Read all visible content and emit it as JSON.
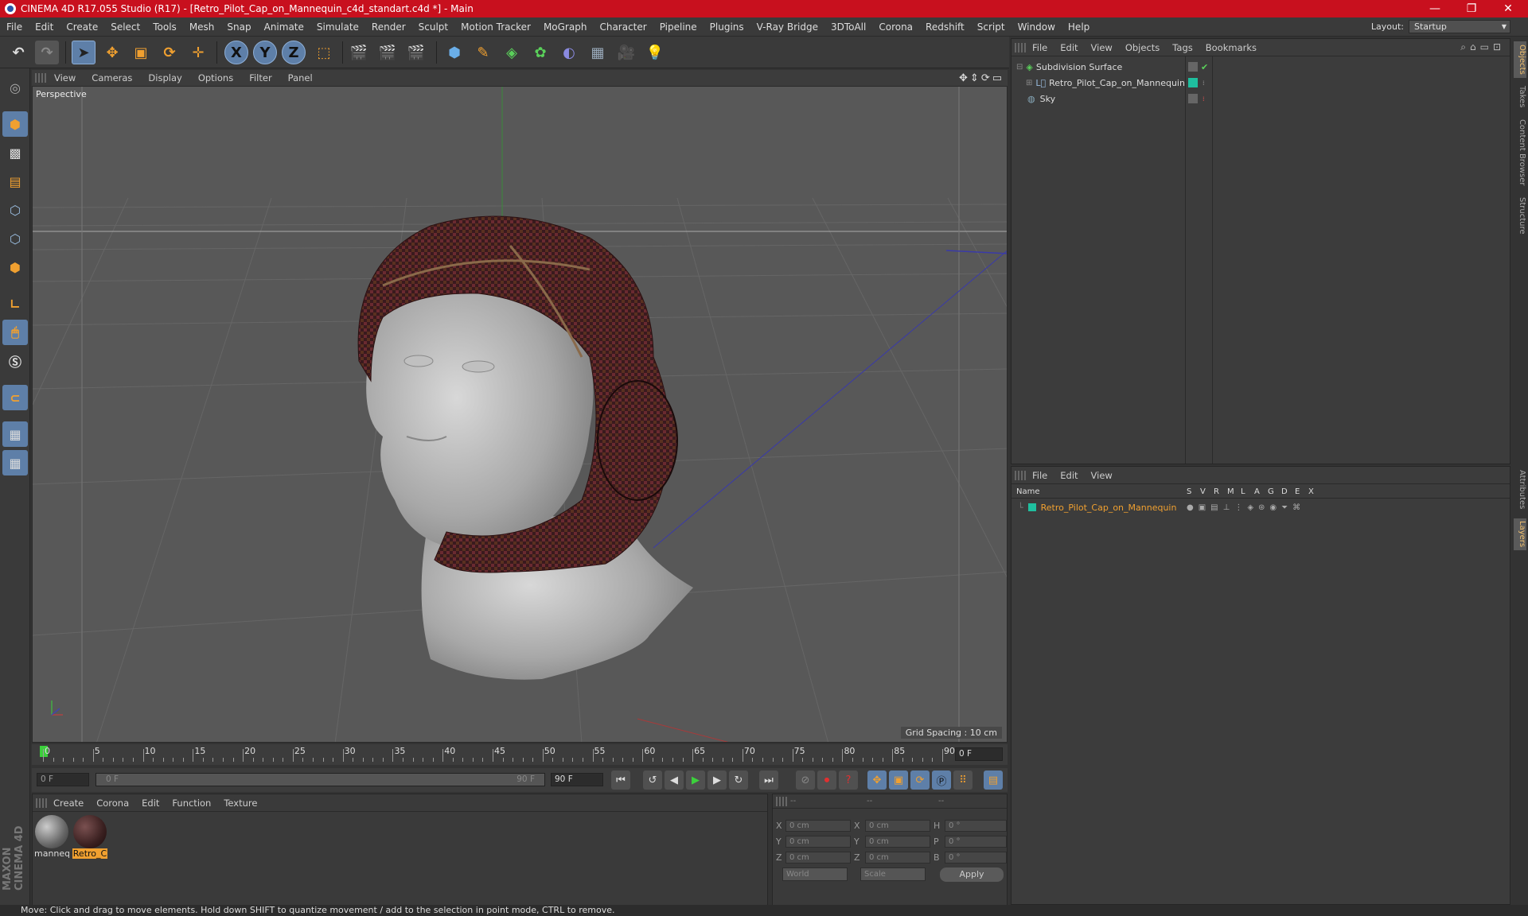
{
  "window": {
    "title": "CINEMA 4D R17.055 Studio (R17) - [Retro_Pilot_Cap_on_Mannequin_c4d_standart.c4d *] - Main",
    "minimize": "—",
    "restore": "❐",
    "close": "✕"
  },
  "menu": [
    "File",
    "Edit",
    "Create",
    "Select",
    "Tools",
    "Mesh",
    "Snap",
    "Animate",
    "Simulate",
    "Render",
    "Sculpt",
    "Motion Tracker",
    "MoGraph",
    "Character",
    "Pipeline",
    "Plugins",
    "V-Ray Bridge",
    "3DToAll",
    "Corona",
    "Redshift",
    "Script",
    "Window",
    "Help"
  ],
  "layout": {
    "label": "Layout:",
    "value": "Startup"
  },
  "toolbar": {
    "x_label": "X",
    "y_label": "Y",
    "z_label": "Z"
  },
  "viewport": {
    "menu": [
      "View",
      "Cameras",
      "Display",
      "Options",
      "Filter",
      "Panel"
    ],
    "label": "Perspective",
    "grid_spacing": "Grid Spacing : 10 cm"
  },
  "timeline": {
    "ticks": [
      "0",
      "5",
      "10",
      "15",
      "20",
      "25",
      "30",
      "35",
      "40",
      "45",
      "50",
      "55",
      "60",
      "65",
      "70",
      "75",
      "80",
      "85",
      "90"
    ],
    "current_frame": "0 F",
    "start": "0 F",
    "range_start": "0 F",
    "range_end": "90 F",
    "end": "90 F"
  },
  "materials": {
    "menu": [
      "Create",
      "Corona",
      "Edit",
      "Function",
      "Texture"
    ],
    "items": [
      {
        "name": "manneq",
        "color": "#8a8a8a"
      },
      {
        "name": "Retro_C",
        "color": "#3a2020"
      }
    ]
  },
  "coords": {
    "header": [
      "--",
      "--",
      "--"
    ],
    "rows": [
      {
        "a": "X",
        "av": "0 cm",
        "b": "X",
        "bv": "0 cm",
        "c": "H",
        "cv": "0 °"
      },
      {
        "a": "Y",
        "av": "0 cm",
        "b": "Y",
        "bv": "0 cm",
        "c": "P",
        "cv": "0 °"
      },
      {
        "a": "Z",
        "av": "0 cm",
        "b": "Z",
        "bv": "0 cm",
        "c": "B",
        "cv": "0 °"
      }
    ],
    "world": "World",
    "scale": "Scale",
    "apply": "Apply"
  },
  "objects": {
    "menu": [
      "File",
      "Edit",
      "View",
      "Objects",
      "Tags",
      "Bookmarks"
    ],
    "items": [
      {
        "name": "Subdivision Surface",
        "indent": 0
      },
      {
        "name": "Retro_Pilot_Cap_on_Mannequin",
        "indent": 1
      },
      {
        "name": "Sky",
        "indent": 0
      }
    ]
  },
  "layers": {
    "menu": [
      "File",
      "Edit",
      "View"
    ],
    "columns": [
      "Name",
      "S",
      "V",
      "R",
      "M",
      "L",
      "A",
      "G",
      "D",
      "E",
      "X"
    ],
    "items": [
      {
        "name": "Retro_Pilot_Cap_on_Mannequin",
        "color": "#1fbf9f"
      }
    ]
  },
  "sidetabs": [
    "Objects",
    "Takes",
    "Content Browser",
    "Structure",
    "Attributes",
    "Layers"
  ],
  "brand": "MAXON CINEMA 4D",
  "status": "Move: Click and drag to move elements. Hold down SHIFT to quantize movement / add to the selection in point mode, CTRL to remove.",
  "colors": {
    "accent": "#f0a030",
    "title_bar": "#c8101e",
    "selection": "#5e7fa8"
  }
}
